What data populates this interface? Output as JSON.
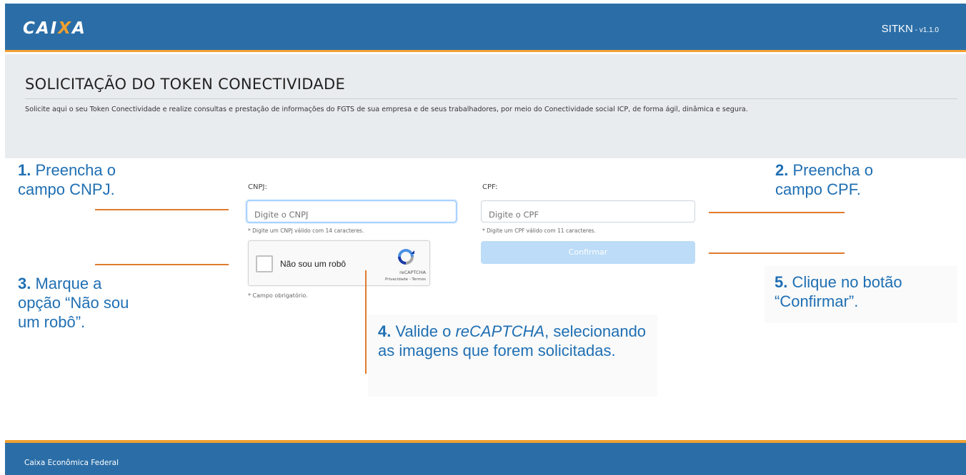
{
  "header": {
    "logo_main": "CAI",
    "logo_x": "X",
    "logo_end": "A",
    "app_name": "SITKN",
    "app_version": " - v1.1.0"
  },
  "intro": {
    "title": "SOLICITAÇÃO DO TOKEN CONECTIVIDADE",
    "description": "Solicite aqui o seu Token Conectividade e realize consultas e prestação de informações do FGTS de sua empresa e de seus trabalhadores, por meio do Conectividade social ICP, de forma ágil, dinâmica e segura."
  },
  "form": {
    "cnpj_label": "CNPJ:",
    "cnpj_placeholder": "Digite o CNPJ",
    "cnpj_value": "",
    "cnpj_hint": "* Digite um CNPJ válido com 14 caracteres.",
    "cpf_label": "CPF:",
    "cpf_placeholder": "Digite o CPF",
    "cpf_value": "",
    "cpf_hint": "* Digite um CPF válido com 11 caracteres.",
    "recaptcha_label": "Não sou um robô",
    "recaptcha_brand": "reCAPTCHA",
    "recaptcha_links": "Privacidade - Termos",
    "required_note": "* Campo obrigatório.",
    "confirm_label": "Confirmar"
  },
  "callouts": [
    {
      "num": "1.",
      "text": " Preencha o campo CNPJ."
    },
    {
      "num": "2.",
      "text": " Preencha o campo CPF."
    },
    {
      "num": "3.",
      "text": " Marque a opção “Não sou um robô”."
    },
    {
      "num": "4.",
      "text_pre": " Valide o ",
      "text_em": "reCAPTCHA",
      "text_post": ", selecionando as imagens que forem solicitadas."
    },
    {
      "num": "5.",
      "text": " Clique no botão “Confirmar”."
    }
  ],
  "footer": {
    "text": "Caixa Econômica Federal"
  },
  "colors": {
    "brand_blue": "#2b6ea7",
    "brand_orange": "#f0a030",
    "callout_blue": "#1f6fb3",
    "leader_orange": "#e07b2e"
  }
}
